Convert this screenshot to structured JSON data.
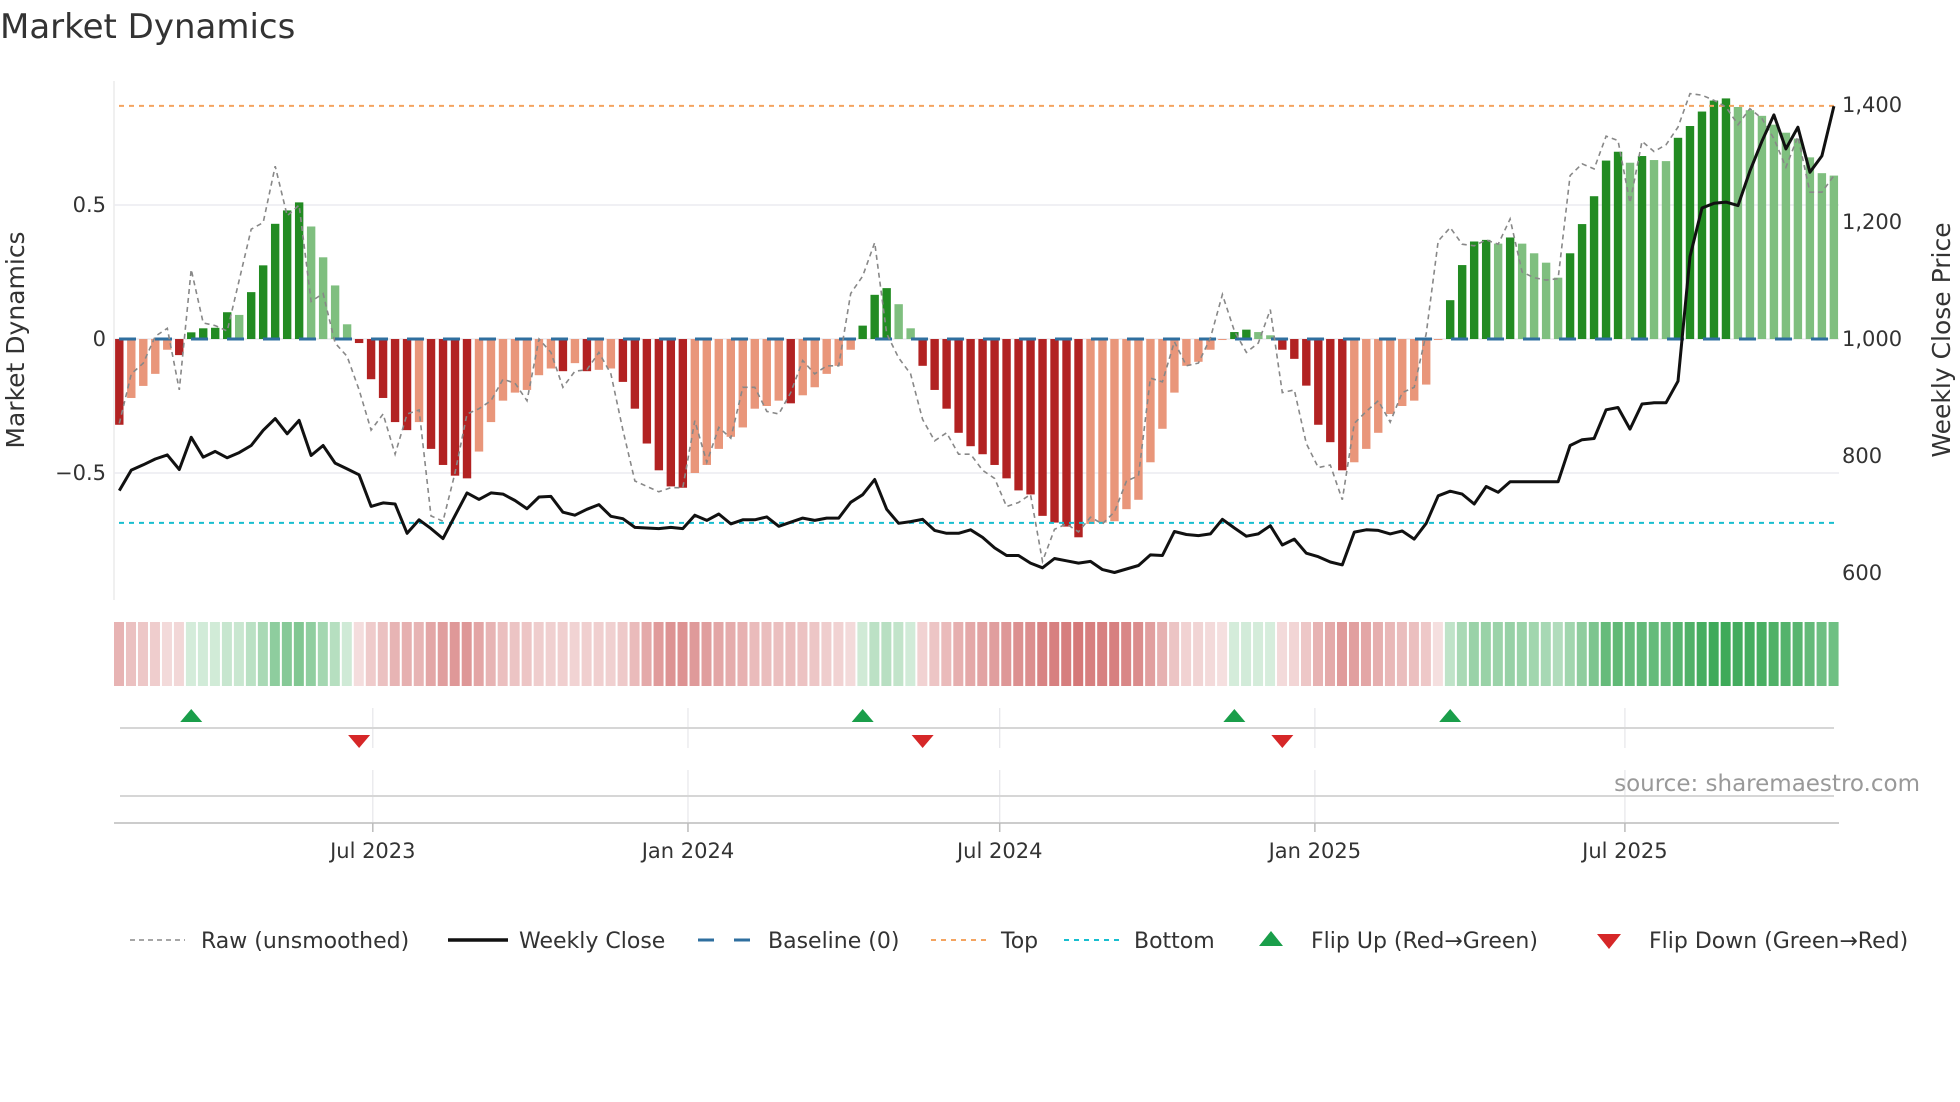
{
  "chart_data": {
    "type": "bar",
    "title": "Market Dynamics",
    "ylabel": "Market Dynamics",
    "y2label": "Weekly Close Price",
    "ylim": [
      -0.974,
      0.963
    ],
    "y2lim": [
      554,
      1441
    ],
    "yticks": [
      {
        "value": 0.5,
        "label": "0.5"
      },
      {
        "value": 0,
        "label": "0"
      },
      {
        "value": -0.5,
        "label": "−0.5"
      }
    ],
    "y2ticks": [
      {
        "value": 1400,
        "label": "1,400"
      },
      {
        "value": 1200,
        "label": "1,200"
      },
      {
        "value": 1000,
        "label": "1,000"
      },
      {
        "value": 800,
        "label": "800"
      },
      {
        "value": 600,
        "label": "600"
      }
    ],
    "x_start": "2023-02-03",
    "x_step_days": 7,
    "xticks": [
      {
        "date": "2023-07-01",
        "label": "Jul 2023"
      },
      {
        "date": "2024-01-01",
        "label": "Jan 2024"
      },
      {
        "date": "2024-07-01",
        "label": "Jul 2024"
      },
      {
        "date": "2025-01-01",
        "label": "Jan 2025"
      },
      {
        "date": "2025-07-01",
        "label": "Jul 2025"
      }
    ],
    "top_level": 0.87,
    "bottom_level": -0.686,
    "baseline": 0,
    "series": [
      {
        "name": "Market Dynamics",
        "kind": "bar",
        "values": [
          -0.32,
          -0.22,
          -0.175,
          -0.13,
          -0.04,
          -0.06,
          0.025,
          0.04,
          0.042,
          0.1,
          0.09,
          0.175,
          0.275,
          0.43,
          0.48,
          0.51,
          0.42,
          0.305,
          0.2,
          0.055,
          -0.015,
          -0.15,
          -0.22,
          -0.31,
          -0.34,
          -0.31,
          -0.41,
          -0.47,
          -0.51,
          -0.52,
          -0.42,
          -0.31,
          -0.23,
          -0.2,
          -0.19,
          -0.135,
          -0.11,
          -0.12,
          -0.09,
          -0.12,
          -0.115,
          -0.11,
          -0.16,
          -0.26,
          -0.39,
          -0.49,
          -0.55,
          -0.555,
          -0.5,
          -0.47,
          -0.41,
          -0.365,
          -0.33,
          -0.26,
          -0.25,
          -0.23,
          -0.24,
          -0.21,
          -0.18,
          -0.13,
          -0.1,
          -0.04,
          0.05,
          0.165,
          0.19,
          0.13,
          0.04,
          -0.1,
          -0.19,
          -0.26,
          -0.35,
          -0.4,
          -0.43,
          -0.47,
          -0.52,
          -0.565,
          -0.58,
          -0.66,
          -0.685,
          -0.7,
          -0.74,
          -0.69,
          -0.685,
          -0.68,
          -0.635,
          -0.6,
          -0.46,
          -0.335,
          -0.2,
          -0.1,
          -0.085,
          -0.04,
          -0.003,
          0.026,
          0.035,
          0.026,
          0.014,
          -0.04,
          -0.074,
          -0.174,
          -0.32,
          -0.385,
          -0.49,
          -0.46,
          -0.41,
          -0.35,
          -0.28,
          -0.25,
          -0.23,
          -0.17,
          -0.003,
          0.145,
          0.276,
          0.364,
          0.37,
          0.356,
          0.379,
          0.356,
          0.32,
          0.285,
          0.229,
          0.32,
          0.429,
          0.533,
          0.666,
          0.699,
          0.658,
          0.683,
          0.668,
          0.664,
          0.751,
          0.795,
          0.849,
          0.89,
          0.898,
          0.866,
          0.854,
          0.833,
          0.8,
          0.77,
          0.748,
          0.678,
          0.619,
          0.61
        ]
      },
      {
        "name": "Raw (unsmoothed)",
        "kind": "line",
        "values": [
          -0.315,
          -0.13,
          -0.09,
          0.01,
          0.04,
          -0.19,
          0.26,
          0.06,
          0.05,
          0.03,
          0.22,
          0.41,
          0.435,
          0.645,
          0.46,
          0.5,
          0.14,
          0.17,
          -0.015,
          -0.065,
          -0.19,
          -0.34,
          -0.28,
          -0.43,
          -0.28,
          -0.265,
          -0.66,
          -0.68,
          -0.5,
          -0.28,
          -0.26,
          -0.23,
          -0.15,
          -0.165,
          -0.23,
          0,
          -0.05,
          -0.18,
          -0.12,
          -0.115,
          -0.05,
          -0.13,
          -0.34,
          -0.53,
          -0.55,
          -0.57,
          -0.555,
          -0.555,
          -0.305,
          -0.46,
          -0.33,
          -0.37,
          -0.18,
          -0.18,
          -0.27,
          -0.28,
          -0.2,
          -0.08,
          -0.13,
          -0.1,
          -0.1,
          0.17,
          0.235,
          0.36,
          0.02,
          -0.07,
          -0.13,
          -0.3,
          -0.38,
          -0.35,
          -0.43,
          -0.43,
          -0.49,
          -0.52,
          -0.625,
          -0.61,
          -0.58,
          -0.83,
          -0.71,
          -0.69,
          -0.72,
          -0.665,
          -0.69,
          -0.645,
          -0.53,
          -0.51,
          -0.146,
          -0.16,
          -0.01,
          -0.1,
          -0.09,
          0.004,
          0.166,
          0.03,
          -0.05,
          -0.015,
          0.11,
          -0.2,
          -0.19,
          -0.39,
          -0.48,
          -0.47,
          -0.6,
          -0.315,
          -0.27,
          -0.23,
          -0.31,
          -0.2,
          -0.18,
          0.02,
          0.366,
          0.416,
          0.354,
          0.348,
          0.37,
          0.354,
          0.448,
          0.25,
          0.229,
          0.22,
          0.225,
          0.61,
          0.654,
          0.635,
          0.757,
          0.741,
          0.508,
          0.738,
          0.7,
          0.725,
          0.791,
          0.916,
          0.91,
          0.891,
          0.866,
          0.8,
          0.86,
          0.823,
          0.748,
          0.641,
          0.756,
          0.548,
          0.548,
          0.61
        ]
      },
      {
        "name": "Weekly Close",
        "kind": "line",
        "axis": "right",
        "values": [
          741,
          776,
          785,
          795,
          802,
          777,
          832,
          798,
          808,
          797,
          806,
          818,
          844,
          864,
          838,
          861,
          801,
          818,
          788,
          778,
          768,
          714,
          720,
          718,
          668,
          691,
          676,
          659,
          698,
          737,
          726,
          737,
          735,
          724,
          710,
          730,
          731,
          704,
          699,
          709,
          717,
          697,
          693,
          678,
          677,
          676,
          678,
          676,
          699,
          690,
          701,
          684,
          691,
          691,
          696,
          680,
          687,
          694,
          690,
          694,
          694,
          721,
          734,
          760,
          709,
          685,
          688,
          692,
          673,
          668,
          668,
          674,
          661,
          643,
          630,
          630,
          617,
          609,
          625,
          621,
          617,
          620,
          606,
          601,
          607,
          613,
          631,
          630,
          671,
          666,
          664,
          667,
          692,
          677,
          663,
          667,
          681,
          648,
          658,
          634,
          628,
          619,
          614,
          670,
          674,
          673,
          667,
          672,
          658,
          685,
          732,
          740,
          735,
          718,
          748,
          738,
          756,
          756,
          756,
          756,
          756,
          818,
          828,
          830,
          879,
          883,
          846,
          889,
          891,
          891,
          928,
          1141,
          1224,
          1232,
          1234,
          1228,
          1287,
          1338,
          1383,
          1325,
          1362,
          1285,
          1313,
          1398
        ]
      }
    ],
    "legend": {
      "placement": "bottom",
      "items": [
        {
          "key": "raw",
          "label": "Raw (unsmoothed)"
        },
        {
          "key": "close",
          "label": "Weekly Close"
        },
        {
          "key": "baseline",
          "label": "Baseline (0)"
        },
        {
          "key": "top",
          "label": "Top"
        },
        {
          "key": "bottom",
          "label": "Bottom"
        },
        {
          "key": "flip_up",
          "label": "Flip Up (Red→Green)"
        },
        {
          "key": "flip_down",
          "label": "Flip Down (Green→Red)"
        }
      ]
    },
    "source": "source: sharemaestro.com"
  },
  "colors": {
    "bar_pos_strong": "#228b22",
    "bar_pos_weak": "#7fbf7f",
    "bar_neg_strong": "#b22222",
    "bar_neg_weak": "#e9967a",
    "close": "#111111",
    "raw": "#888888",
    "baseline": "#2f6f9f",
    "top": "#f4a460",
    "bottom": "#17becf",
    "flip_up": "#1a9e4a",
    "flip_down": "#d62728"
  }
}
